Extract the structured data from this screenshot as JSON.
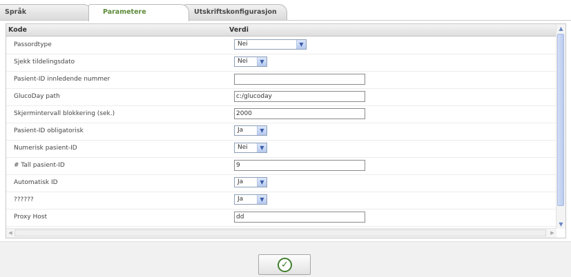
{
  "tabs": [
    {
      "label": "Språk",
      "active": false
    },
    {
      "label": "Parametere",
      "active": true
    },
    {
      "label": "Utskriftskonfigurasjon",
      "active": false
    }
  ],
  "grid": {
    "headers": {
      "kode": "Kode",
      "verdi": "Verdi"
    },
    "rows": [
      {
        "label": "Passordtype",
        "type": "select",
        "value": "Nei"
      },
      {
        "label": "Sjekk tildelingsdato",
        "type": "select",
        "value": "Nei"
      },
      {
        "label": "Pasient-ID innledende nummer",
        "type": "text",
        "value": ""
      },
      {
        "label": "GlucoDay path",
        "type": "text",
        "value": "c:/glucoday"
      },
      {
        "label": "Skjermintervall blokkering (sek.)",
        "type": "text",
        "value": "2000"
      },
      {
        "label": "Pasient-ID obligatorisk",
        "type": "select",
        "value": "Ja"
      },
      {
        "label": "Numerisk pasient-ID",
        "type": "select",
        "value": "Nei"
      },
      {
        "label": "# Tall pasient-ID",
        "type": "text",
        "value": "9"
      },
      {
        "label": "Automatisk ID",
        "type": "select",
        "value": "Ja"
      },
      {
        "label": "??????",
        "type": "select",
        "value": "Ja"
      },
      {
        "label": "Proxy Host",
        "type": "text",
        "value": "dd"
      }
    ]
  },
  "icons": {
    "dropdown": "chevron-down-icon",
    "confirm": "check-circle-icon"
  },
  "colors": {
    "active_tab_text": "#5c8a3a",
    "confirm_icon": "#3f7f2c",
    "dropdown_accent": "#3b5ea8"
  }
}
